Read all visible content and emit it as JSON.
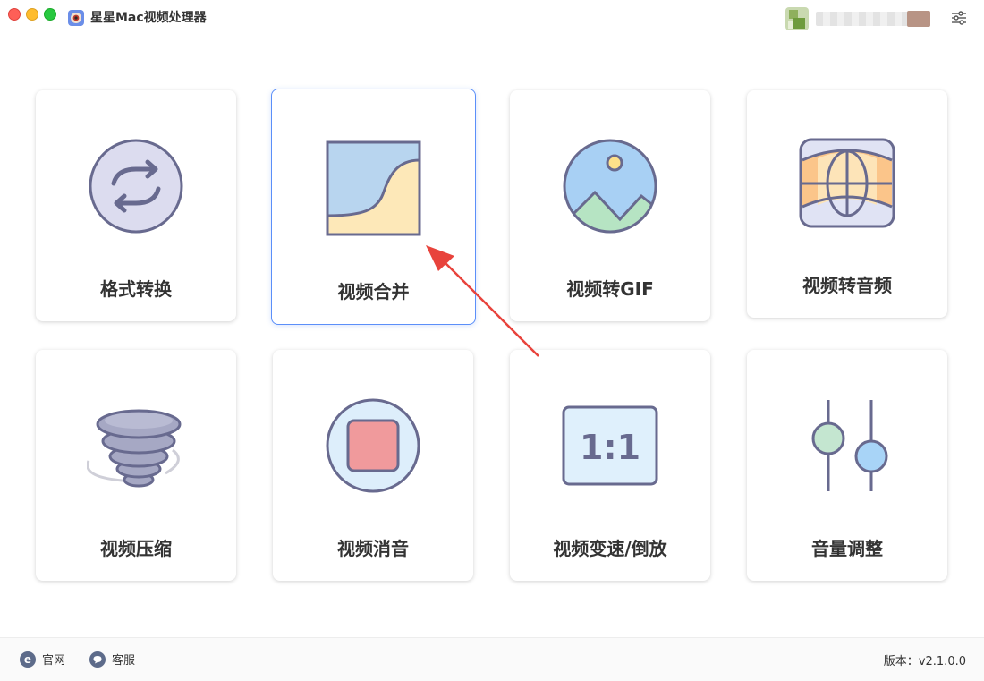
{
  "window": {
    "title": "星星Mac视频处理器"
  },
  "tools": [
    {
      "label": "格式转换",
      "icon": "refresh-icon"
    },
    {
      "label": "视频合并",
      "icon": "merge-icon"
    },
    {
      "label": "视频转GIF",
      "icon": "gif-picture-icon"
    },
    {
      "label": "视频转音频",
      "icon": "audio-globe-icon"
    },
    {
      "label": "视频压缩",
      "icon": "tornado-icon"
    },
    {
      "label": "视频消音",
      "icon": "stop-icon"
    },
    {
      "label": "视频变速/倒放",
      "icon": "aspect-ratio-icon"
    },
    {
      "label": "音量调整",
      "icon": "sliders-icon"
    }
  ],
  "icon_texts": {
    "aspect_ratio": "1:1"
  },
  "footer": {
    "website_label": "官网",
    "service_label": "客服",
    "version_label": "版本：",
    "version_value": "v2.1.0.0"
  },
  "colors": {
    "accent": "#5b8ff9",
    "icon_stroke": "#686a8f",
    "arrow": "#e8433c"
  }
}
